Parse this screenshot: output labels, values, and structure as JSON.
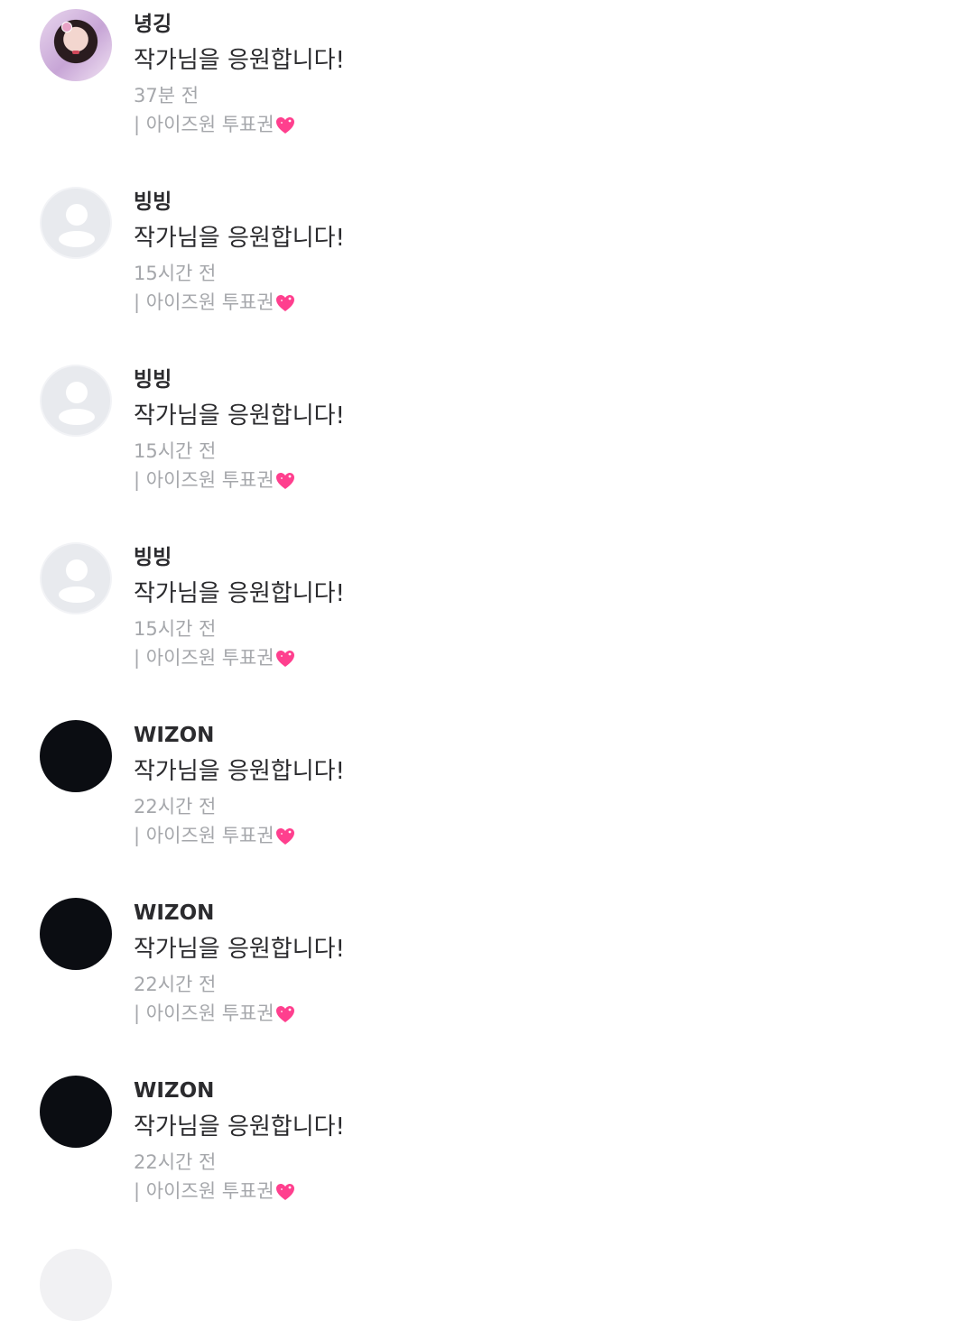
{
  "comments": [
    {
      "username": "녕깅",
      "message": "작가님을 응원합니다!",
      "time": "37분 전",
      "gift": "| 아이즈원 투표권",
      "avatar": "photo"
    },
    {
      "username": "빙빙",
      "message": "작가님을 응원합니다!",
      "time": "15시간 전",
      "gift": "| 아이즈원 투표권",
      "avatar": "default"
    },
    {
      "username": "빙빙",
      "message": "작가님을 응원합니다!",
      "time": "15시간 전",
      "gift": "| 아이즈원 투표권",
      "avatar": "default"
    },
    {
      "username": "빙빙",
      "message": "작가님을 응원합니다!",
      "time": "15시간 전",
      "gift": "| 아이즈원 투표권",
      "avatar": "default"
    },
    {
      "username": "WIZON",
      "message": "작가님을 응원합니다!",
      "time": "22시간 전",
      "gift": "| 아이즈원 투표권",
      "avatar": "dark"
    },
    {
      "username": "WIZON",
      "message": "작가님을 응원합니다!",
      "time": "22시간 전",
      "gift": "| 아이즈원 투표권",
      "avatar": "dark"
    },
    {
      "username": "WIZON",
      "message": "작가님을 응원합니다!",
      "time": "22시간 전",
      "gift": "| 아이즈원 투표권",
      "avatar": "dark"
    }
  ],
  "icons": {
    "gift_icon": "sparkling-heart-icon",
    "default_avatar_icon": "user-silhouette-icon"
  },
  "colors": {
    "text_primary": "#2b2b2e",
    "text_secondary": "#a5a7ab",
    "heart_pink": "#ff3f8e"
  }
}
